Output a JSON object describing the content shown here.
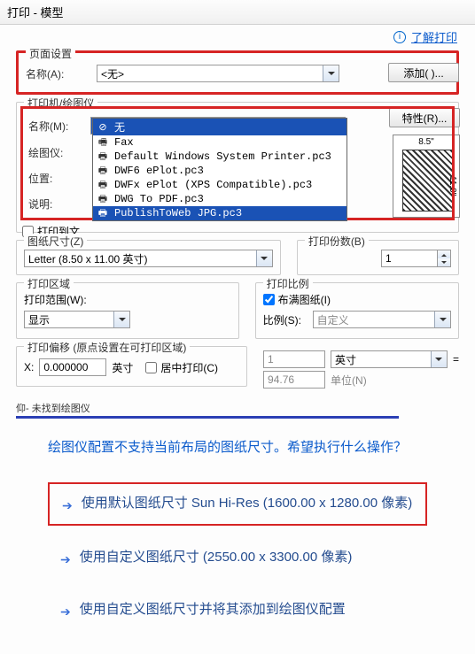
{
  "titlebar": {
    "title": "打印 - 模型"
  },
  "help": {
    "learn_label": "了解打印"
  },
  "page_setup": {
    "group_title": "页面设置",
    "name_label": "名称(A):",
    "name_value": "<无>",
    "add_button": "添加( )..."
  },
  "printer": {
    "group_title": "打印机/绘图仪",
    "name_label": "名称(M):",
    "name_value": "无",
    "plotter_label": "绘图仪:",
    "location_label": "位置:",
    "description_label": "说明:",
    "properties_button": "特性(R)...",
    "options": [
      {
        "icon": "none",
        "label": "无"
      },
      {
        "icon": "fax",
        "label": "Fax"
      },
      {
        "icon": "printer",
        "label": "Default Windows System Printer.pc3"
      },
      {
        "icon": "dwf",
        "label": "DWF6 ePlot.pc3"
      },
      {
        "icon": "dwf",
        "label": "DWFx ePlot (XPS Compatible).pc3"
      },
      {
        "icon": "pdf",
        "label": "DWG To PDF.pc3"
      },
      {
        "icon": "jpg",
        "label": "PublishToWeb JPG.pc3"
      }
    ],
    "selected_top": "无",
    "highlighted": "PublishToWeb JPG.pc3",
    "paper_width": "8.5\"",
    "paper_height": "11.0\"",
    "print_to_file_label": "打印到文"
  },
  "paper_size": {
    "group_title": "图纸尺寸(Z)",
    "value": "Letter (8.50 x 11.00 英寸)"
  },
  "copies": {
    "group_title": "打印份数(B)",
    "value": "1"
  },
  "print_area": {
    "group_title": "打印区域",
    "range_label": "打印范围(W):",
    "range_value": "显示"
  },
  "plot_scale": {
    "group_title": "打印比例",
    "fit_label": "布满图纸(I)",
    "scale_label": "比例(S):",
    "scale_value": "自定义",
    "unit1_value": "1",
    "unit1_unit": "英寸",
    "unit2_value": "94.76",
    "unit2_unit": "单位(N)"
  },
  "plot_offset": {
    "group_title": "打印偏移 (原点设置在可打印区域)",
    "x_label": "X:",
    "x_value": "0.000000",
    "x_unit": "英寸",
    "center_label": "居中打印(C)"
  },
  "footer": {
    "truncated": "仰- 未找到绘图仪"
  },
  "below": {
    "question": "绘图仪配置不支持当前布局的图纸尺寸。希望执行什么操作？",
    "opt1": "使用默认图纸尺寸 Sun Hi-Res (1600.00 x 1280.00 像素)",
    "opt2": "使用自定义图纸尺寸  (2550.00 x 3300.00 像素)",
    "opt3": "使用自定义图纸尺寸并将其添加到绘图仪配置"
  }
}
